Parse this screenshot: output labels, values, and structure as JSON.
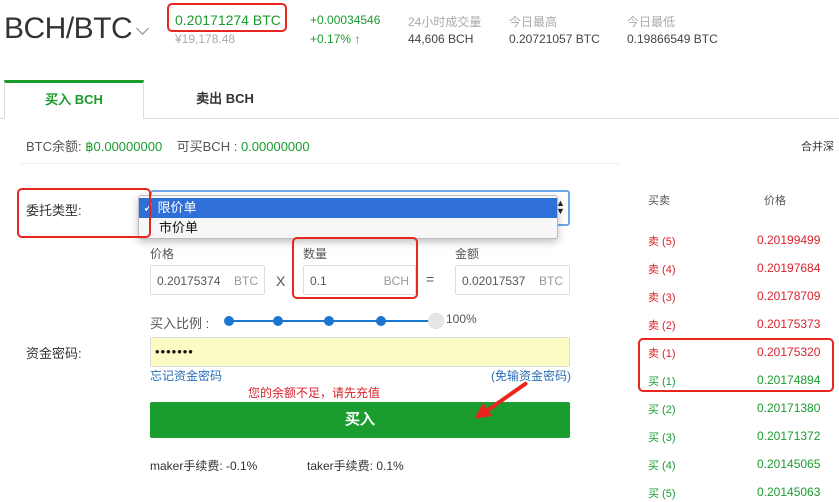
{
  "header": {
    "pair": "BCH/BTC",
    "last_price": "0.20171274 BTC",
    "last_price_cny": "¥19,178.48",
    "change_abs": "+0.00034546",
    "change_pct": "+0.17%",
    "change_arrow": "↑",
    "volume_label": "24小时成交量",
    "volume_value": "44,606 BCH",
    "high_label": "今日最高",
    "high_value": "0.20721057 BTC",
    "low_label": "今日最低",
    "low_value": "0.19866549 BTC"
  },
  "tabs": {
    "buy": "买入 BCH",
    "sell": "卖出 BCH"
  },
  "balance": {
    "btc_label": "BTC余额: ",
    "btc_value": "฿0.00000000",
    "can_buy_label": "可买BCH : ",
    "can_buy_value": "0.00000000",
    "merge_depth": "合并深"
  },
  "form": {
    "order_type_label": "委托类型:",
    "order_type_options": [
      "限价单",
      "市价单"
    ],
    "order_type_check": "✓",
    "price_label": "价格",
    "price_value": "0.20175374",
    "price_unit": "BTC",
    "times": "X",
    "amount_label": "数量",
    "amount_value": "0.1",
    "amount_unit": "BCH",
    "equals": "=",
    "total_label": "金额",
    "total_value": "0.02017537",
    "total_unit": "BTC",
    "ratio_label": "买入比例 :",
    "ratio_max": "100%",
    "password_label": "资金密码:",
    "password_mask": "•••••••",
    "forgot_link": "忘记资金密码",
    "no_pwd_link": "(免输资金密码)",
    "warning": "您的余额不足，请先充值",
    "buy_button": "买入",
    "maker_fee": "maker手续费: -0.1%",
    "taker_fee": "taker手续费: 0.1%"
  },
  "orderbook": {
    "col_side": "买卖",
    "col_price": "价格",
    "rows": [
      {
        "side": "卖 (5)",
        "price": "0.20199499",
        "type": "sell"
      },
      {
        "side": "卖 (4)",
        "price": "0.20197684",
        "type": "sell"
      },
      {
        "side": "卖 (3)",
        "price": "0.20178709",
        "type": "sell"
      },
      {
        "side": "卖 (2)",
        "price": "0.20175373",
        "type": "sell"
      },
      {
        "side": "卖 (1)",
        "price": "0.20175320",
        "type": "sell"
      },
      {
        "side": "买 (1)",
        "price": "0.20174894",
        "type": "buy"
      },
      {
        "side": "买 (2)",
        "price": "0.20171380",
        "type": "buy"
      },
      {
        "side": "买 (3)",
        "price": "0.20171372",
        "type": "buy"
      },
      {
        "side": "买 (4)",
        "price": "0.20145065",
        "type": "buy"
      },
      {
        "side": "买 (5)",
        "price": "0.20145063",
        "type": "buy"
      }
    ]
  },
  "colors": {
    "accent_green": "#1a9c2e",
    "sell_red": "#d9222a",
    "annotation_red": "#e8261f",
    "link_blue": "#2a6db4"
  }
}
